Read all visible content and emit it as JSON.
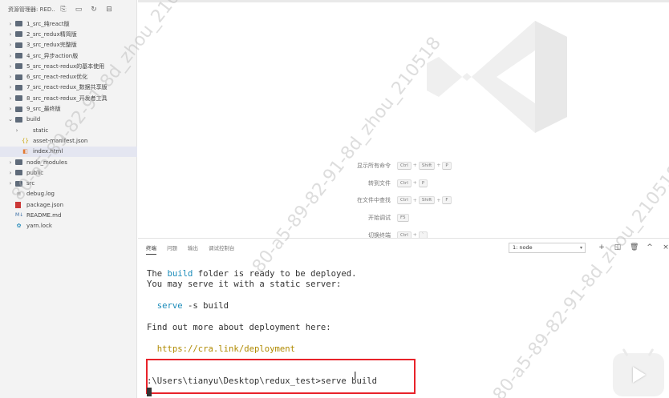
{
  "sidebar": {
    "title": "资源管理器: RED...",
    "actions": [
      "new-file-icon",
      "new-folder-icon",
      "refresh-icon",
      "collapse-all-icon"
    ],
    "tree": [
      {
        "label": "1_src_纯react版",
        "type": "folder",
        "depth": 0,
        "expanded": false
      },
      {
        "label": "2_src_redux精简版",
        "type": "folder",
        "depth": 0,
        "expanded": false
      },
      {
        "label": "3_src_redux完整版",
        "type": "folder",
        "depth": 0,
        "expanded": false
      },
      {
        "label": "4_src_异步action版",
        "type": "folder",
        "depth": 0,
        "expanded": false
      },
      {
        "label": "5_src_react-redux的基本使用",
        "type": "folder",
        "depth": 0,
        "expanded": false
      },
      {
        "label": "6_src_react-redux优化",
        "type": "folder",
        "depth": 0,
        "expanded": false
      },
      {
        "label": "7_src_react-redux_数据共享版",
        "type": "folder",
        "depth": 0,
        "expanded": false
      },
      {
        "label": "8_src_react-redux_开发者工具",
        "type": "folder",
        "depth": 0,
        "expanded": false
      },
      {
        "label": "9_src_最终版",
        "type": "folder",
        "depth": 0,
        "expanded": false
      },
      {
        "label": "build",
        "type": "folder",
        "depth": 0,
        "expanded": true
      },
      {
        "label": "static",
        "type": "folder",
        "depth": 1,
        "expanded": false
      },
      {
        "label": "asset-manifest.json",
        "type": "json",
        "depth": 1
      },
      {
        "label": "index.html",
        "type": "html",
        "depth": 1,
        "active": true
      },
      {
        "label": "node_modules",
        "type": "folder",
        "depth": 0,
        "expanded": false
      },
      {
        "label": "public",
        "type": "folder",
        "depth": 0,
        "expanded": false
      },
      {
        "label": "src",
        "type": "folder",
        "depth": 0,
        "expanded": false
      },
      {
        "label": "debug.log",
        "type": "log",
        "depth": 0
      },
      {
        "label": "package.json",
        "type": "pkg",
        "depth": 0
      },
      {
        "label": "README.md",
        "type": "md",
        "depth": 0
      },
      {
        "label": "yarn.lock",
        "type": "yarn",
        "depth": 0
      }
    ]
  },
  "editor": {
    "shortcuts": [
      {
        "label": "显示所有命令",
        "keys": [
          "Ctrl",
          "Shift",
          "P"
        ]
      },
      {
        "label": "转到文件",
        "keys": [
          "Ctrl",
          "P"
        ]
      },
      {
        "label": "在文件中查找",
        "keys": [
          "Ctrl",
          "Shift",
          "F"
        ]
      },
      {
        "label": "开始调试",
        "keys": [
          "F5"
        ]
      },
      {
        "label": "切换终端",
        "keys": [
          "Ctrl",
          "`"
        ]
      }
    ]
  },
  "panel": {
    "tabs": [
      {
        "label": "终端",
        "active": true
      },
      {
        "label": "问题",
        "active": false
      },
      {
        "label": "输出",
        "active": false
      },
      {
        "label": "调试控制台",
        "active": false
      }
    ],
    "terminal_select": "1: node",
    "actions": [
      "add-terminal-icon",
      "split-terminal-icon",
      "trash-icon",
      "maximize-panel-icon",
      "close-panel-icon"
    ]
  },
  "terminal": {
    "line1_pre": "The ",
    "line1_word": "build",
    "line1_post": " folder is ready to be deployed.",
    "line2": "You may serve it with a static server:",
    "serve_cmd": "serve",
    "serve_args": " -s build",
    "line4": "Find out more about deployment here:",
    "link": "https://cra.link/deployment",
    "prompt": ":\\Users\\tianyu\\Desktop\\redux_test>serve build"
  },
  "watermark": "80-a5-89-82-91-8d_zhou_210518",
  "colors": {
    "accent_blue": "#1a8bb9",
    "link_yellow": "#b08a00",
    "highlight_red": "#e8232a"
  }
}
